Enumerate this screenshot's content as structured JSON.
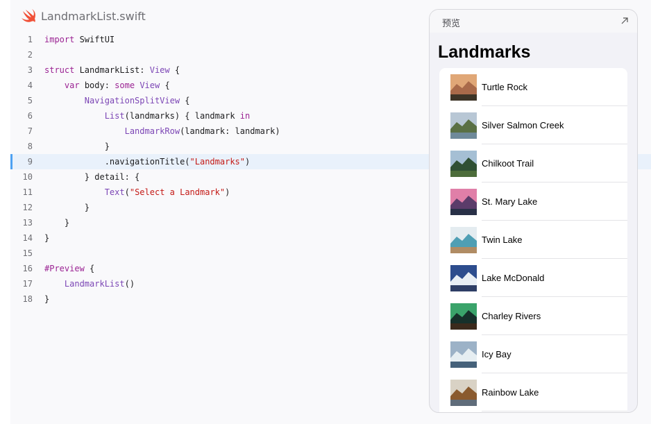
{
  "file": {
    "name": "LandmarkList.swift",
    "icon": "swift-logo-icon"
  },
  "code_lines": [
    {
      "n": "1",
      "parts": [
        {
          "t": "import",
          "c": "k"
        },
        {
          "t": " SwiftUI",
          "c": ""
        }
      ]
    },
    {
      "n": "2",
      "parts": []
    },
    {
      "n": "3",
      "parts": [
        {
          "t": "struct",
          "c": "k"
        },
        {
          "t": " LandmarkList: ",
          "c": ""
        },
        {
          "t": "View",
          "c": "t"
        },
        {
          "t": " {",
          "c": ""
        }
      ]
    },
    {
      "n": "4",
      "parts": [
        {
          "t": "    ",
          "c": ""
        },
        {
          "t": "var",
          "c": "k"
        },
        {
          "t": " body: ",
          "c": ""
        },
        {
          "t": "some",
          "c": "k"
        },
        {
          "t": " ",
          "c": ""
        },
        {
          "t": "View",
          "c": "t"
        },
        {
          "t": " {",
          "c": ""
        }
      ]
    },
    {
      "n": "5",
      "parts": [
        {
          "t": "        ",
          "c": ""
        },
        {
          "t": "NavigationSplitView",
          "c": "t"
        },
        {
          "t": " {",
          "c": ""
        }
      ]
    },
    {
      "n": "6",
      "parts": [
        {
          "t": "            ",
          "c": ""
        },
        {
          "t": "List",
          "c": "t"
        },
        {
          "t": "(landmarks) { landmark ",
          "c": ""
        },
        {
          "t": "in",
          "c": "k"
        }
      ]
    },
    {
      "n": "7",
      "parts": [
        {
          "t": "                ",
          "c": ""
        },
        {
          "t": "LandmarkRow",
          "c": "t"
        },
        {
          "t": "(landmark: landmark)",
          "c": ""
        }
      ]
    },
    {
      "n": "8",
      "parts": [
        {
          "t": "            }",
          "c": ""
        }
      ]
    },
    {
      "n": "9",
      "parts": [
        {
          "t": "            .navigationTitle(",
          "c": ""
        },
        {
          "t": "\"Landmarks\"",
          "c": "s"
        },
        {
          "t": ")",
          "c": ""
        }
      ],
      "highlight": true
    },
    {
      "n": "10",
      "parts": [
        {
          "t": "        } detail: {",
          "c": ""
        }
      ]
    },
    {
      "n": "11",
      "parts": [
        {
          "t": "            ",
          "c": ""
        },
        {
          "t": "Text",
          "c": "t"
        },
        {
          "t": "(",
          "c": ""
        },
        {
          "t": "\"Select a Landmark\"",
          "c": "s"
        },
        {
          "t": ")",
          "c": ""
        }
      ]
    },
    {
      "n": "12",
      "parts": [
        {
          "t": "        }",
          "c": ""
        }
      ]
    },
    {
      "n": "13",
      "parts": [
        {
          "t": "    }",
          "c": ""
        }
      ]
    },
    {
      "n": "14",
      "parts": [
        {
          "t": "}",
          "c": ""
        }
      ]
    },
    {
      "n": "15",
      "parts": []
    },
    {
      "n": "16",
      "parts": [
        {
          "t": "#Preview",
          "c": "k"
        },
        {
          "t": " {",
          "c": ""
        }
      ]
    },
    {
      "n": "17",
      "parts": [
        {
          "t": "    ",
          "c": ""
        },
        {
          "t": "LandmarkList",
          "c": "t"
        },
        {
          "t": "()",
          "c": ""
        }
      ]
    },
    {
      "n": "18",
      "parts": [
        {
          "t": "}",
          "c": ""
        }
      ]
    }
  ],
  "preview": {
    "label": "预览",
    "expand_icon": "expand-arrow-icon",
    "nav_title": "Landmarks",
    "rows": [
      {
        "label": "Turtle Rock",
        "thumb": [
          "#e0a777",
          "#a96a4a",
          "#3d3427"
        ]
      },
      {
        "label": "Silver Salmon Creek",
        "thumb": [
          "#b8c7d5",
          "#5a7044",
          "#6f8a9a"
        ]
      },
      {
        "label": "Chilkoot Trail",
        "thumb": [
          "#a5bfd4",
          "#2f5034",
          "#4d6d3b"
        ]
      },
      {
        "label": "St. Mary Lake",
        "thumb": [
          "#e07fa8",
          "#5b3c6a",
          "#283047"
        ]
      },
      {
        "label": "Twin Lake",
        "thumb": [
          "#e4ecf0",
          "#4f9fb4",
          "#b08c64"
        ]
      },
      {
        "label": "Lake McDonald",
        "thumb": [
          "#2d4d8e",
          "#e8eef5",
          "#2e3e66"
        ]
      },
      {
        "label": "Charley Rivers",
        "thumb": [
          "#3aa36a",
          "#16302a",
          "#3b2a1c"
        ]
      },
      {
        "label": "Icy Bay",
        "thumb": [
          "#9cb2c7",
          "#e6eef2",
          "#45617a"
        ]
      },
      {
        "label": "Rainbow Lake",
        "thumb": [
          "#d9d2c5",
          "#8a5a2e",
          "#5f6c7a"
        ]
      }
    ]
  }
}
